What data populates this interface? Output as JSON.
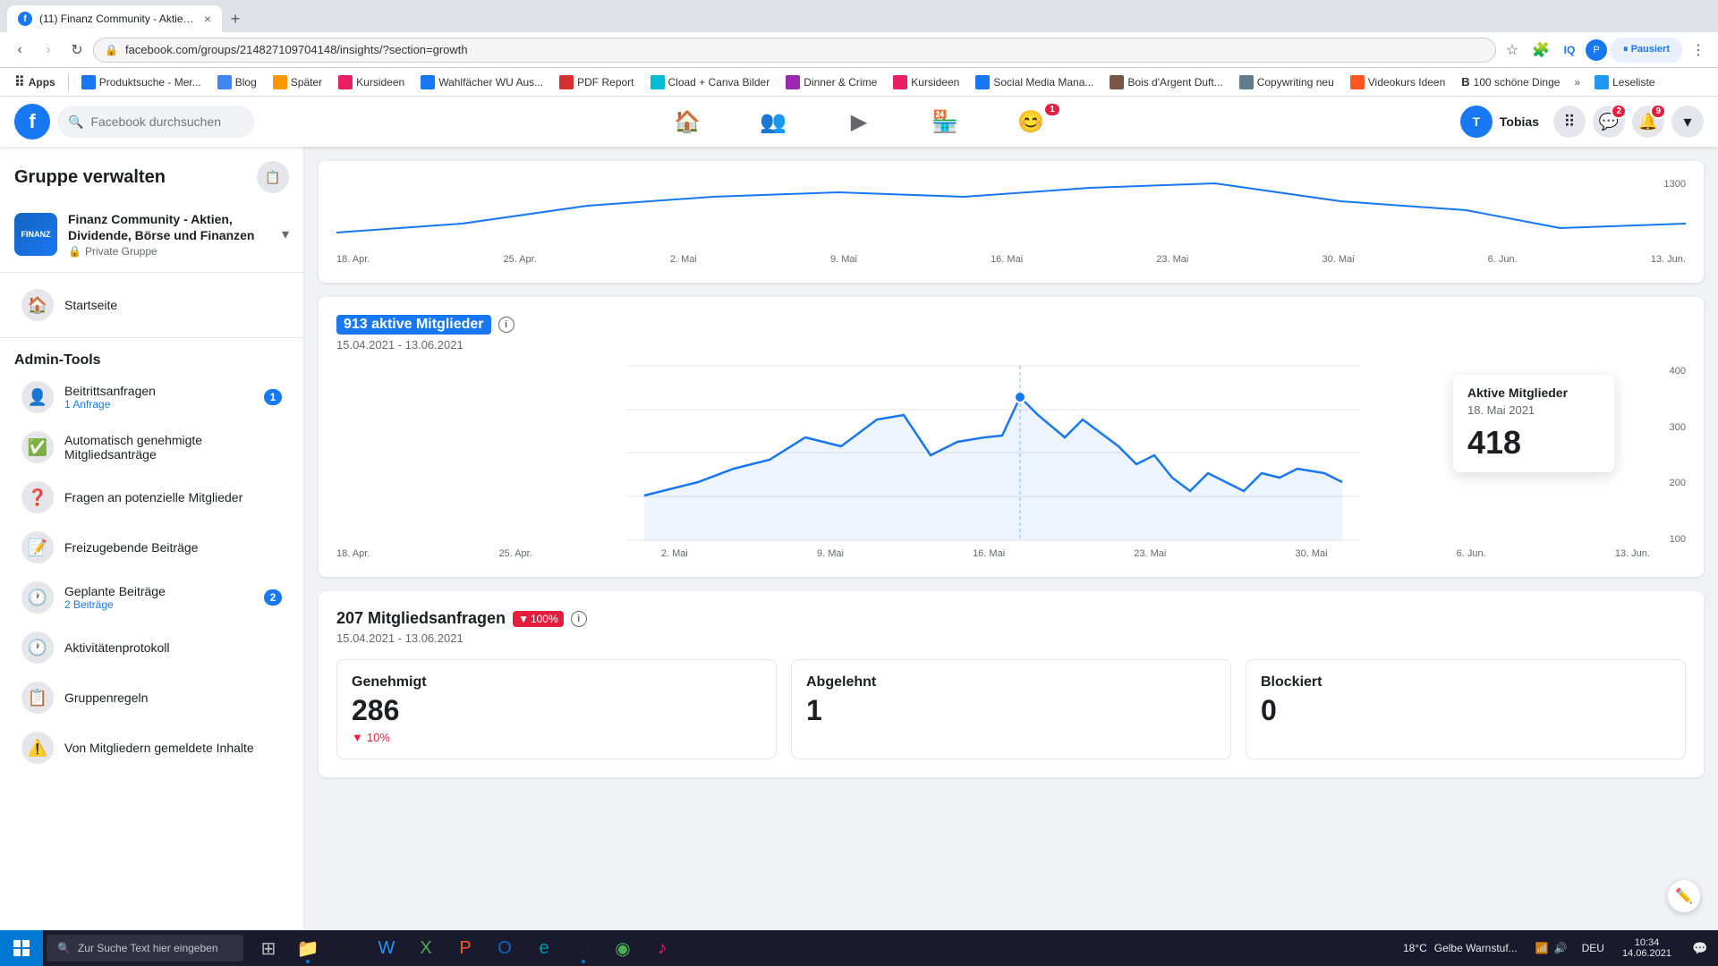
{
  "browser": {
    "tab_title": "(11) Finanz Community - Aktien...",
    "tab_favicon": "f",
    "url": "facebook.com/groups/214827109704148/insights/?section=growth",
    "back_disabled": false,
    "forward_disabled": false,
    "bookmarks": [
      {
        "label": "Apps",
        "type": "apps"
      },
      {
        "label": "Produktsuche - Mer...",
        "icon_color": "#1877f2"
      },
      {
        "label": "Blog",
        "icon_color": "#4285f4"
      },
      {
        "label": "Später",
        "icon_color": "#ff9800"
      },
      {
        "label": "Kursideen",
        "icon_color": "#e91e63"
      },
      {
        "label": "Wahlfächer WU Aus...",
        "icon_color": "#1877f2"
      },
      {
        "label": "PDF Report",
        "icon_color": "#d32f2f"
      },
      {
        "label": "Cload + Canva Bilder",
        "icon_color": "#00bcd4"
      },
      {
        "label": "Dinner & Crime",
        "icon_color": "#9c27b0"
      },
      {
        "label": "Kursideen",
        "icon_color": "#e91e63"
      },
      {
        "label": "Social Media Mana...",
        "icon_color": "#1877f2"
      },
      {
        "label": "Bois d'Argent Duft...",
        "icon_color": "#795548"
      },
      {
        "label": "Copywriting neu",
        "icon_color": "#607d8b"
      },
      {
        "label": "Videokurs Ideen",
        "icon_color": "#ff5722"
      },
      {
        "label": "100 schöne Dinge",
        "icon_color": "#9c27b0"
      },
      {
        "label": "Leseliste",
        "icon_color": "#2196f3"
      }
    ]
  },
  "topnav": {
    "search_placeholder": "Facebook durchsuchen",
    "username": "Tobias",
    "nav_items": [
      {
        "icon": "🏠",
        "active": false
      },
      {
        "icon": "👥",
        "active": false
      },
      {
        "icon": "▶",
        "active": false
      },
      {
        "icon": "🏪",
        "active": false
      },
      {
        "icon": "😊",
        "active": false,
        "badge": "1"
      }
    ],
    "messenger_badge": "2",
    "notifications_badge": "9"
  },
  "sidebar": {
    "title": "Gruppe verwalten",
    "group_name": "Finanz Community - Aktien, Dividende, Börse und Finanzen",
    "group_privacy": "Private Gruppe",
    "admin_tools_title": "Admin-Tools",
    "items": [
      {
        "label": "Beitrittsanfragen",
        "sub": "1 Anfrage",
        "badge": "1"
      },
      {
        "label": "Automatisch genehmigte Mitgliedsanträge",
        "sub": null,
        "badge": null
      },
      {
        "label": "Fragen an potenzielle Mitglieder",
        "sub": null,
        "badge": null
      },
      {
        "label": "Freizugebende Beiträge",
        "sub": null,
        "badge": null
      },
      {
        "label": "Geplante Beiträge",
        "sub": "2 Beiträge",
        "badge": "2"
      },
      {
        "label": "Aktivitätenprotokoll",
        "sub": null,
        "badge": null
      },
      {
        "label": "Gruppenregeln",
        "sub": null,
        "badge": null
      },
      {
        "label": "Von Mitgliedern gemeldete Inhalte",
        "sub": null,
        "badge": null
      }
    ]
  },
  "chart1": {
    "title": "913 aktive Mitglieder",
    "date_range": "15.04.2021 - 13.06.2021",
    "tooltip_title": "Aktive Mitglieder",
    "tooltip_date": "18. Mai 2021",
    "tooltip_value": "418",
    "y_labels": [
      "400",
      "300",
      "200",
      "100"
    ],
    "x_labels": [
      "18. Apr.",
      "25. Apr.",
      "2. Mai",
      "9. Mai",
      "16. Mai",
      "23. Mai",
      "30. Mai",
      "6. Jun.",
      "13. Jun."
    ]
  },
  "chart2": {
    "title": "207 Mitgliedsanfragen",
    "trend": "100%",
    "date_range": "15.04.2021 - 13.06.2021",
    "stats": [
      {
        "label": "Genehmigt",
        "value": "286",
        "change": "▼ 10%"
      },
      {
        "label": "Abgelehnt",
        "value": "1",
        "change": null
      },
      {
        "label": "Blockiert",
        "value": "0",
        "change": null
      }
    ]
  },
  "top_chart": {
    "y_label": "1300",
    "x_labels": [
      "18. Apr.",
      "25. Apr.",
      "2. Mai",
      "9. Mai",
      "16. Mai",
      "23. Mai",
      "30. Mai",
      "6. Jun.",
      "13. Jun."
    ]
  },
  "taskbar": {
    "search_placeholder": "Zur Suche Text hier eingeben",
    "time": "10:34",
    "date": "14.06.2021",
    "language": "DEU",
    "temperature": "18°C",
    "weather": "Gelbe Warnstuf..."
  }
}
